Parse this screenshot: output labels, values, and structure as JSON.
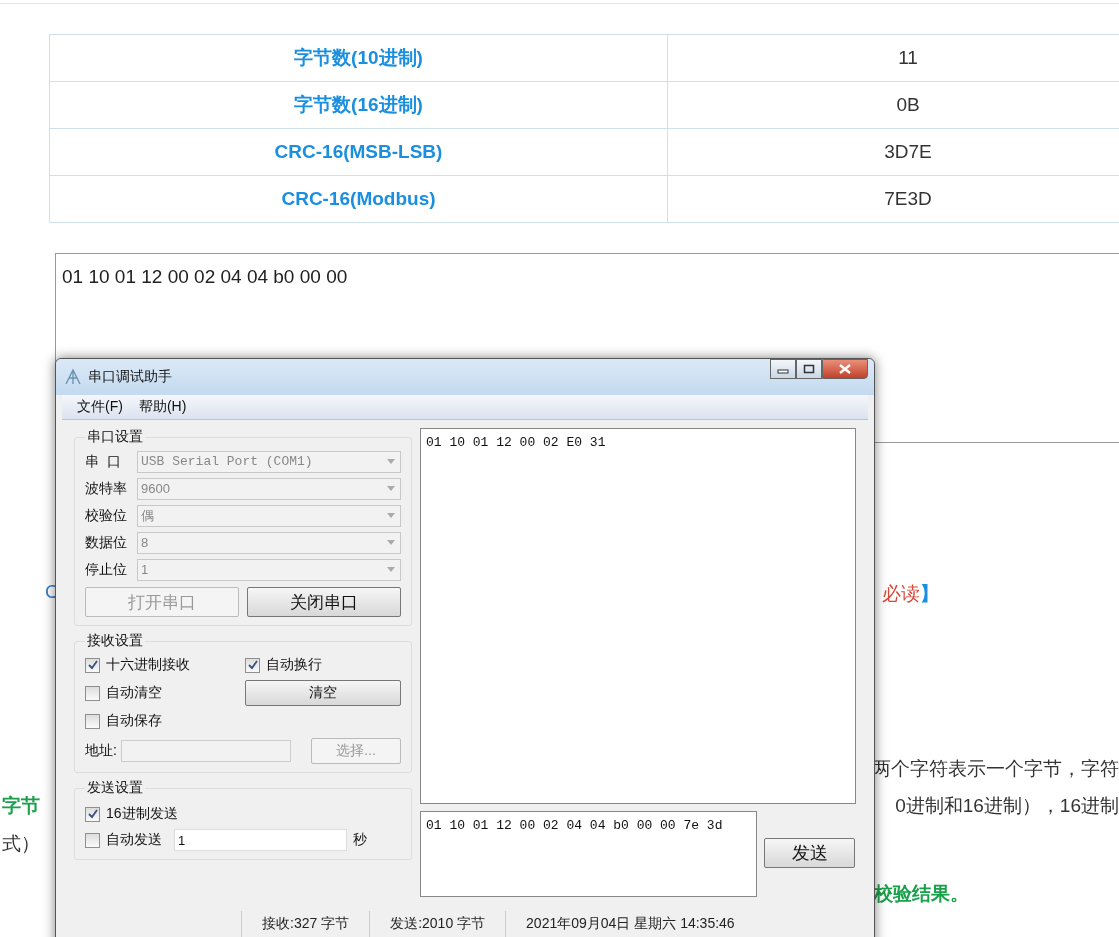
{
  "table": {
    "rows": [
      {
        "label": "字节数(10进制)",
        "value": "11"
      },
      {
        "label": "字节数(16进制)",
        "value": "0B"
      },
      {
        "label": "CRC-16(MSB-LSB)",
        "value": "3D7E"
      },
      {
        "label": "CRC-16(Modbus)",
        "value": "7E3D"
      }
    ]
  },
  "input_area": {
    "value": "01 10 01 12 00 02 04 04 b0 00 00"
  },
  "page_lines": [
    {
      "left": [
        {
          "text": "C",
          "kind": "link"
        }
      ],
      "right": [
        {
          "text": "必读",
          "kind": "red"
        },
        {
          "text": "】",
          "kind": "bracket"
        }
      ]
    },
    {
      "right": [
        {
          "text": "两个字符表示一个字节，字符",
          "kind": "plain"
        }
      ]
    },
    {
      "left": [
        {
          "text": "字节",
          "kind": "green"
        }
      ],
      "right": [
        {
          "text": "0进制和16进制），16进制",
          "kind": "plain"
        }
      ]
    },
    {
      "left": [
        {
          "text": "式）",
          "kind": "plain"
        }
      ]
    },
    {
      "right": [
        {
          "text": "校验结果。",
          "kind": "green"
        }
      ]
    }
  ],
  "window": {
    "title": "串口调试助手",
    "menu": [
      "文件(F)",
      "帮助(H)"
    ],
    "serial_settings": {
      "title": "串口设置",
      "fields": [
        {
          "label": "串  口",
          "value": "USB Serial Port (COM1)"
        },
        {
          "label": "波特率",
          "value": "9600"
        },
        {
          "label": "校验位",
          "value": "偶"
        },
        {
          "label": "数据位",
          "value": "8"
        },
        {
          "label": "停止位",
          "value": "1"
        }
      ],
      "buttons": [
        {
          "label": "打开串口",
          "disabled": true
        },
        {
          "label": "关闭串口",
          "disabled": false
        }
      ]
    },
    "receive_settings": {
      "title": "接收设置",
      "checkboxes": [
        {
          "label": "十六进制接收",
          "checked": true
        },
        {
          "label": "自动换行",
          "checked": true
        },
        {
          "label": "自动清空",
          "checked": false
        },
        {
          "label": "自动保存",
          "checked": false
        }
      ],
      "clear_button": "清空",
      "address_label": "地址:",
      "select_button": {
        "label": "选择...",
        "disabled": true
      }
    },
    "send_settings": {
      "title": "发送设置",
      "checkboxes": [
        {
          "label": "16进制发送",
          "checked": true
        },
        {
          "label": "自动发送",
          "checked": false
        }
      ],
      "interval": "1",
      "unit": "秒"
    },
    "receive_display": "01 10 01 12 00 02 E0 31",
    "send_input": "01 10 01 12 00 02 04 04 b0 00 00 7e 3d",
    "send_button": "发送",
    "status_bar": [
      "接收:327 字节",
      "发送:2010 字节",
      "2021年09月04日 星期六 14:35:46"
    ]
  }
}
